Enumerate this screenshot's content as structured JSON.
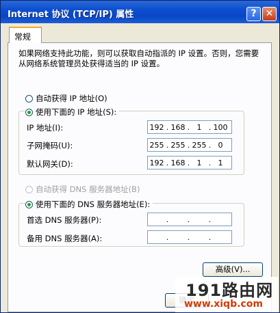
{
  "window": {
    "title": "Internet 协议 (TCP/IP) 属性"
  },
  "titlebar": {
    "help_label": "?",
    "close_label": "✕"
  },
  "tab": {
    "label": "常规"
  },
  "description": "如果网络支持此功能，则可以获取自动指派的 IP 设置。否则，您需要从网络系统管理员处获得适当的 IP 设置。",
  "ip_section": {
    "auto_label": "自动获得 IP 地址(O)",
    "manual_label": "使用下面的 IP 地址(S):",
    "selected": "manual",
    "fields": [
      {
        "label": "IP 地址(I):",
        "octets": [
          "192",
          "168",
          "1",
          "100"
        ]
      },
      {
        "label": "子网掩码(U):",
        "octets": [
          "255",
          "255",
          "255",
          "0"
        ]
      },
      {
        "label": "默认网关(D):",
        "octets": [
          "192",
          "168",
          "1",
          "1"
        ]
      }
    ]
  },
  "dns_section": {
    "auto_label": "自动获得 DNS 服务器地址(B)",
    "manual_label": "使用下面的 DNS 服务器地址(E):",
    "selected": "manual",
    "fields": [
      {
        "label": "首选 DNS 服务器(P):",
        "octets": [
          "",
          "",
          "",
          ""
        ]
      },
      {
        "label": "备用 DNS 服务器(A):",
        "octets": [
          "",
          "",
          "",
          ""
        ]
      }
    ]
  },
  "buttons": {
    "advanced_label": "高级(V)...",
    "ok_partial": "确定"
  },
  "watermark": {
    "top": "191路由网",
    "bottom": "www.xiqb.com"
  }
}
